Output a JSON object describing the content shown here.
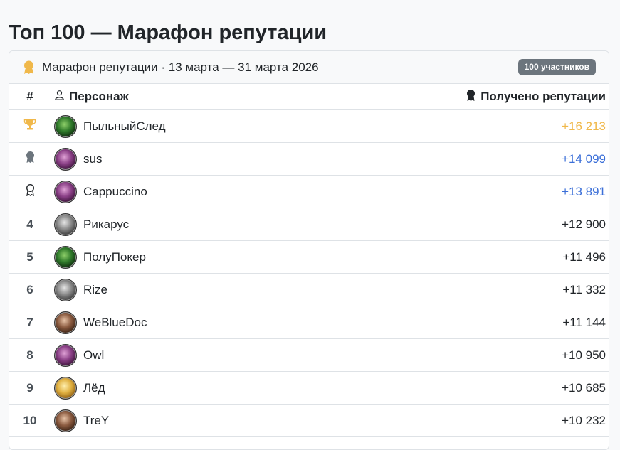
{
  "page": {
    "title": "Топ 100 — Марафон репутации"
  },
  "header": {
    "title": "Марафон репутации · 13 марта — 31 марта 2026",
    "participants_badge": "100 участников"
  },
  "columns": {
    "rank": "#",
    "character": "Персонаж",
    "reputation": "Получено репутации"
  },
  "colors": {
    "gold": "#f0b84a",
    "blue": "#3b6fd8",
    "badge": "#6c757d",
    "silver": "#6c757d"
  },
  "rows": [
    {
      "rank": "",
      "medal": "trophy",
      "name": "ПыльныйСлед",
      "rep": "+16 213",
      "avatar": "green"
    },
    {
      "rank": "",
      "medal": "silver-medal",
      "name": "sus",
      "rep": "+14 099",
      "avatar": "pink"
    },
    {
      "rank": "",
      "medal": "bronze-medal",
      "name": "Cappuccino",
      "rep": "+13 891",
      "avatar": "pink"
    },
    {
      "rank": "4",
      "medal": "",
      "name": "Рикарус",
      "rep": "+12 900",
      "avatar": "gray"
    },
    {
      "rank": "5",
      "medal": "",
      "name": "ПолуПокер",
      "rep": "+11 496",
      "avatar": "green"
    },
    {
      "rank": "6",
      "medal": "",
      "name": "Rize",
      "rep": "+11 332",
      "avatar": "gray"
    },
    {
      "rank": "7",
      "medal": "",
      "name": "WeBlueDoc",
      "rep": "+11 144",
      "avatar": "brown"
    },
    {
      "rank": "8",
      "medal": "",
      "name": "Owl",
      "rep": "+10 950",
      "avatar": "pink"
    },
    {
      "rank": "9",
      "medal": "",
      "name": "Лёд",
      "rep": "+10 685",
      "avatar": "gold"
    },
    {
      "rank": "10",
      "medal": "",
      "name": "TreY",
      "rep": "+10 232",
      "avatar": "brown"
    }
  ]
}
